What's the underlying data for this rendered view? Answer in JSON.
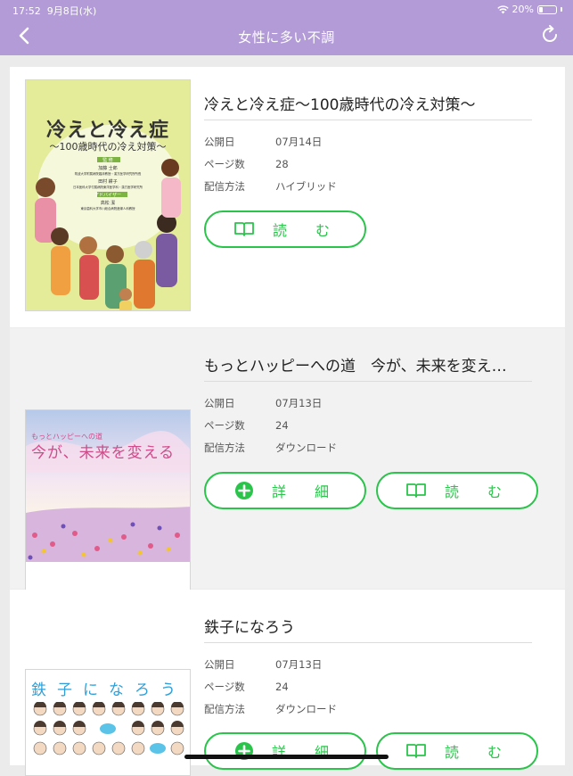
{
  "status_bar": {
    "time": "17:52",
    "date": "9月8日(水)",
    "battery": "20%"
  },
  "nav": {
    "title": "女性に多い不調"
  },
  "labels": {
    "published": "公開日",
    "pages": "ページ数",
    "delivery": "配信方法",
    "read": "読　む",
    "detail": "詳　細"
  },
  "books": [
    {
      "title": "冷えと冷え症〜100歳時代の冷え対策〜",
      "date": "07月14日",
      "pages": "28",
      "delivery": "ハイブリッド",
      "cover": {
        "title": "冷えと冷え症",
        "subtitle": "〜100歳時代の冷え対策〜",
        "supervisor_tag": "監 修",
        "supervisor_1": "加藤 士郎",
        "supervisor_1_org": "筑波大学附属病院臨床教授・漢方医学研究所所長",
        "supervisor_2": "田村 耕子",
        "supervisor_2_org": "日本医科大学付属病院東洋医学科・漢方医学研究所",
        "adviser_tag": "アドバイザー",
        "adviser": "高松 潔",
        "adviser_org": "東京歯科大学市川総合病院産婦人科教授"
      }
    },
    {
      "title": "もっとハッピーへの道　今が、未来を変え…",
      "date": "07月13日",
      "pages": "24",
      "delivery": "ダウンロード",
      "cover": {
        "small_title": "もっとハッピーへの道",
        "title": "今が、未来を変える"
      }
    },
    {
      "title": "鉄子になろう",
      "date": "07月13日",
      "pages": "24",
      "delivery": "ダウンロード",
      "cover": {
        "title": "鉄子になろう"
      }
    }
  ],
  "colors": {
    "header": "#b29bd7",
    "accent": "#2ac44b"
  },
  "icons": {
    "back": "chevron-left-icon",
    "refresh": "refresh-icon",
    "read": "book-icon",
    "detail": "plus-circle-icon"
  }
}
